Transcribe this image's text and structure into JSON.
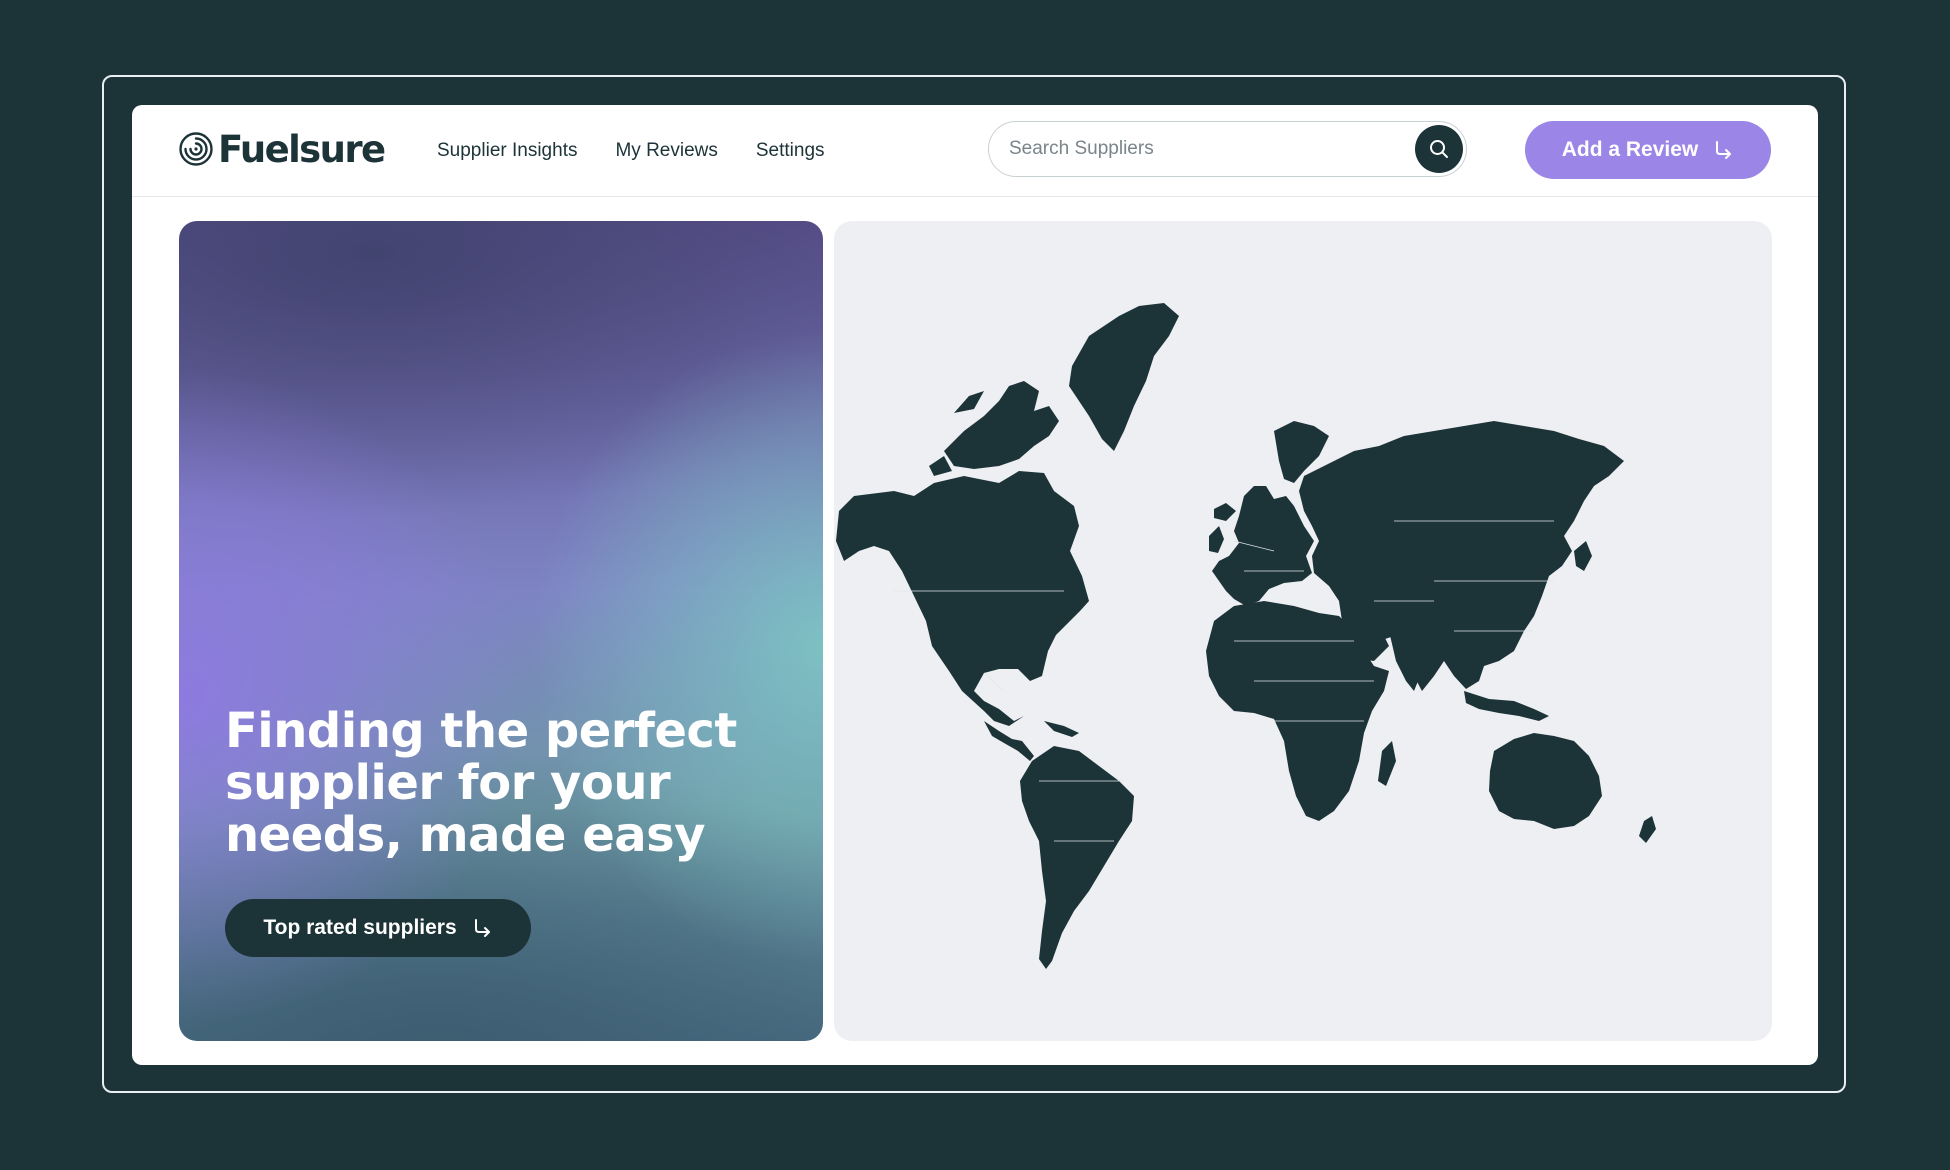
{
  "brand": {
    "name": "Fuelsure",
    "colors": {
      "background": "#1c3338",
      "primary_dark": "#1c3338",
      "accent": "#9b86e8",
      "map_panel": "#edeff2",
      "card": "#ffffff"
    }
  },
  "header": {
    "nav": [
      {
        "label": "Supplier Insights"
      },
      {
        "label": "My Reviews"
      },
      {
        "label": "Settings"
      }
    ],
    "search": {
      "placeholder": "Search Suppliers",
      "value": "",
      "icon": "search-icon"
    },
    "add_review": {
      "label": "Add a Review",
      "icon": "arrow-return-right-icon"
    }
  },
  "hero": {
    "title_lines": [
      "Finding the perfect",
      "supplier for your",
      "needs, made easy"
    ],
    "cta": {
      "label": "Top rated suppliers",
      "icon": "arrow-return-right-icon"
    }
  },
  "map": {
    "type": "world-map",
    "land_color": "#1c3338"
  }
}
